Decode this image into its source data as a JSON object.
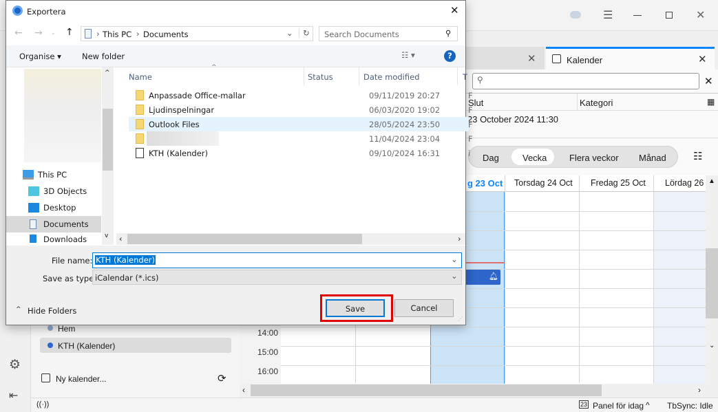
{
  "app": {
    "tab_inactive_close": "×",
    "active_tab": "Kalender",
    "search_placeholder": "",
    "columns": {
      "end": "Slut",
      "category": "Kategori"
    },
    "event_row_end": "23 October 2024 11:30",
    "views": [
      "Dag",
      "Vecka",
      "Flera veckor",
      "Månad"
    ],
    "selected_view": "Vecka",
    "day_headers": [
      "g 23 Oct",
      "Torsdag 24 Oct",
      "Fredag 25 Oct",
      "Lördag 26 Oct"
    ],
    "times": [
      "14:00",
      "15:00",
      "16:00"
    ],
    "calendars": [
      {
        "name": "Hem",
        "color": "#8fa8cc"
      },
      {
        "name": "KTH (Kalender)",
        "color": "#2f66cc",
        "selected": true
      }
    ],
    "new_calendar": "Ny kalender...",
    "status": {
      "today_pane": "Panel för idag",
      "today_day": "23",
      "tbsync": "TbSync: Idle"
    },
    "accent": "#0a84ff",
    "today_col": "#cce4f7",
    "event_color": "#2f66cc"
  },
  "dialog": {
    "title": "Exportera",
    "breadcrumb": [
      "This PC",
      "Documents"
    ],
    "search_placeholder": "Search Documents",
    "toolbar": {
      "organise": "Organise ▾",
      "new_folder": "New folder"
    },
    "headers": {
      "name": "Name",
      "status": "Status",
      "date": "Date modified",
      "type": "T"
    },
    "files": [
      {
        "name": "Anpassade Office-mallar",
        "date": "09/11/2019 20:27",
        "type": "F",
        "kind": "folder"
      },
      {
        "name": "Ljudinspelningar",
        "date": "06/03/2020 19:02",
        "type": "F",
        "kind": "folder"
      },
      {
        "name": "Outlook Files",
        "date": "28/05/2024 23:50",
        "type": "F",
        "kind": "folder",
        "hover": true
      },
      {
        "name": "",
        "date": "11/04/2024 23:04",
        "type": "F",
        "kind": "folder",
        "blurred": true
      },
      {
        "name": "KTH (Kalender)",
        "date": "09/10/2024 16:31",
        "type": "i",
        "kind": "calendar"
      }
    ],
    "nav": [
      {
        "name": "This PC"
      },
      {
        "name": "3D Objects"
      },
      {
        "name": "Desktop"
      },
      {
        "name": "Documents",
        "selected": true
      },
      {
        "name": "Downloads"
      }
    ],
    "file_name_label": "File name:",
    "file_name": "KTH (Kalender)",
    "save_type_label": "Save as type:",
    "save_type": "iCalendar (*.ics)",
    "hide_folders": "Hide Folders",
    "save": "Save",
    "cancel": "Cancel",
    "highlight_color": "#e00000"
  }
}
